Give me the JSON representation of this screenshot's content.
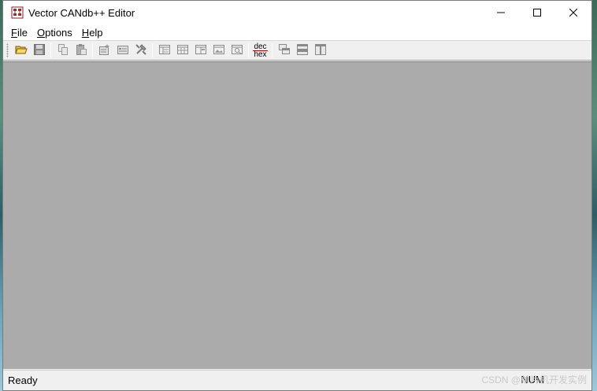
{
  "window": {
    "title": "Vector CANdb++ Editor",
    "icon": "candb-app-icon"
  },
  "title_controls": {
    "minimize": "minimize-icon",
    "maximize": "maximize-icon",
    "close": "close-icon"
  },
  "menu": {
    "file": {
      "hotkey": "F",
      "rest": "ile"
    },
    "options": {
      "hotkey": "O",
      "rest": "ptions"
    },
    "help": {
      "hotkey": "H",
      "rest": "elp"
    }
  },
  "toolbar": {
    "dec_label": "dec",
    "hex_label": "hex"
  },
  "statusbar": {
    "left": "Ready",
    "num": "NUM"
  },
  "watermark": "CSDN @单片机开发实例"
}
